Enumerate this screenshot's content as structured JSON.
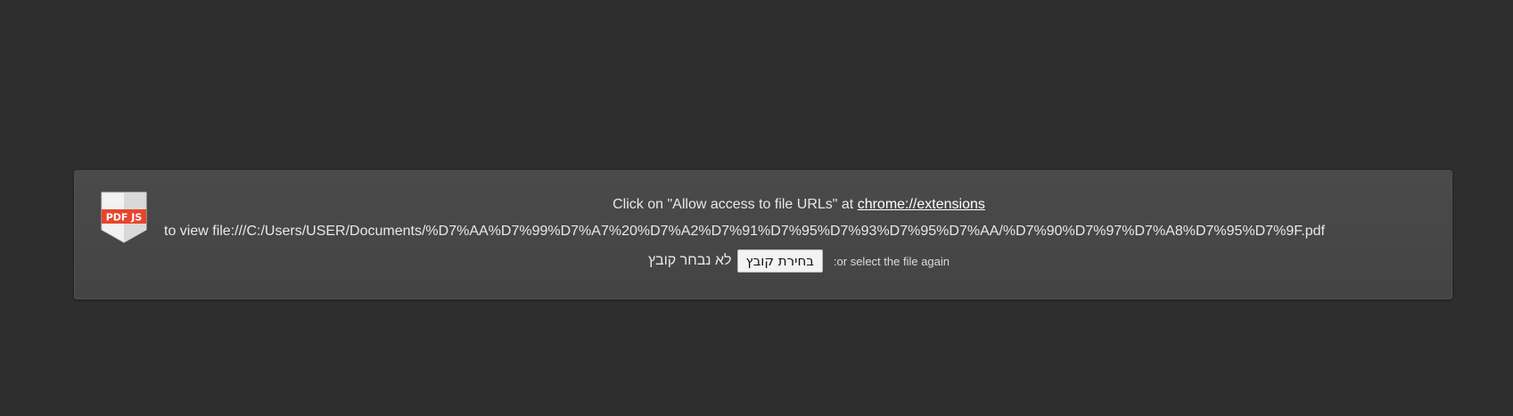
{
  "notice": {
    "logo_text": "PDF JS",
    "line1_prefix": "Click on \"Allow access to file URLs\" at ",
    "extensions_link": "chrome://extensions",
    "line2": "to view file:///C:/Users/USER/Documents/%D7%AA%D7%99%D7%A7%20%D7%A2%D7%91%D7%95%D7%93%D7%95%D7%AA/%D7%90%D7%97%D7%A8%D7%95%D7%9F.pdf",
    "no_file_text": "לא נבחר קובץ",
    "choose_file_label": "בחירת קובץ",
    "select_again_text": ":or select the file again"
  },
  "colors": {
    "background": "#2e2e2e",
    "panel": "#474747",
    "logo_red": "#e8452c"
  }
}
